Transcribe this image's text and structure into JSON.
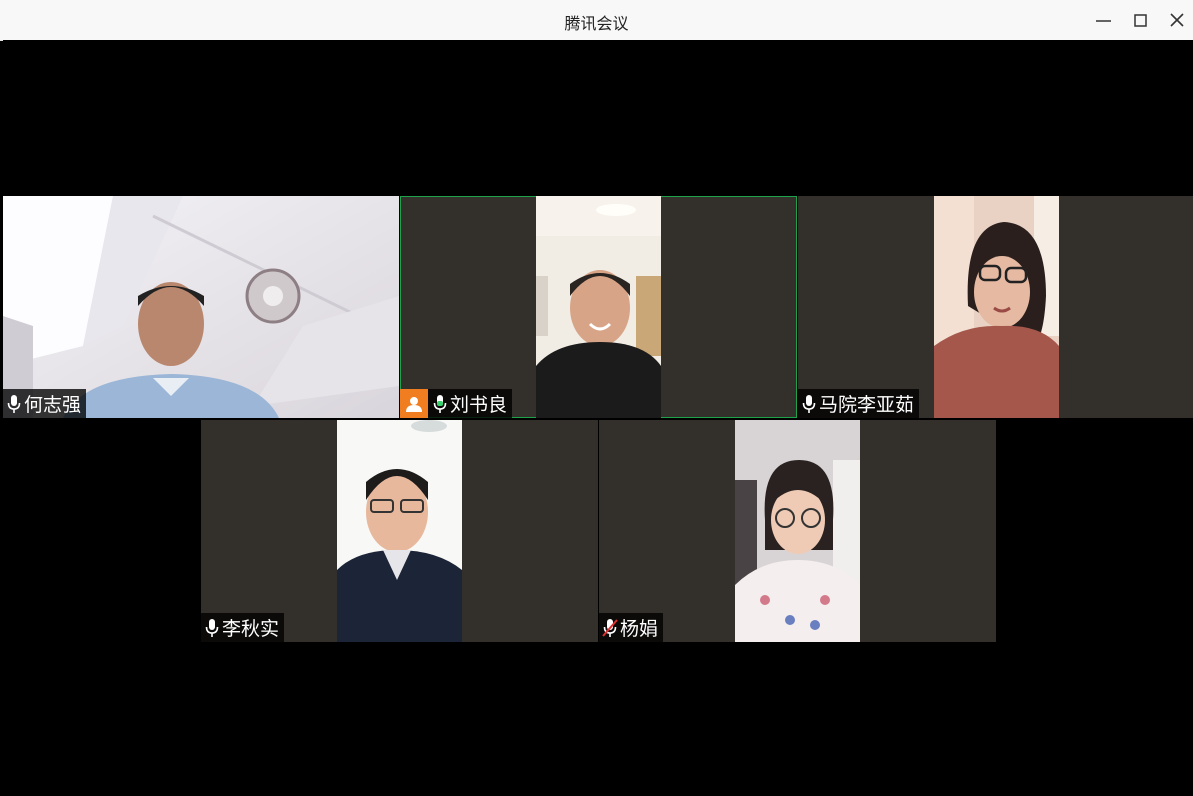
{
  "window": {
    "title": "腾讯会议",
    "controls": [
      "minimize-icon",
      "maximize-icon",
      "close-icon"
    ],
    "accent_color": "#2d6fdc"
  },
  "participants": [
    {
      "name": "何志强",
      "mic": "on",
      "host": false,
      "speaking": false
    },
    {
      "name": "刘书良",
      "mic": "on",
      "host": true,
      "speaking": true,
      "host_badge_color": "#f07d1f",
      "speaking_color": "#1fa34a"
    },
    {
      "name": "马院李亚茹",
      "mic": "on",
      "host": false,
      "speaking": false
    },
    {
      "name": "李秋实",
      "mic": "on",
      "host": false,
      "speaking": false
    },
    {
      "name": "杨娟",
      "mic": "muted",
      "host": false,
      "speaking": false,
      "muted_color": "#e03131"
    }
  ]
}
